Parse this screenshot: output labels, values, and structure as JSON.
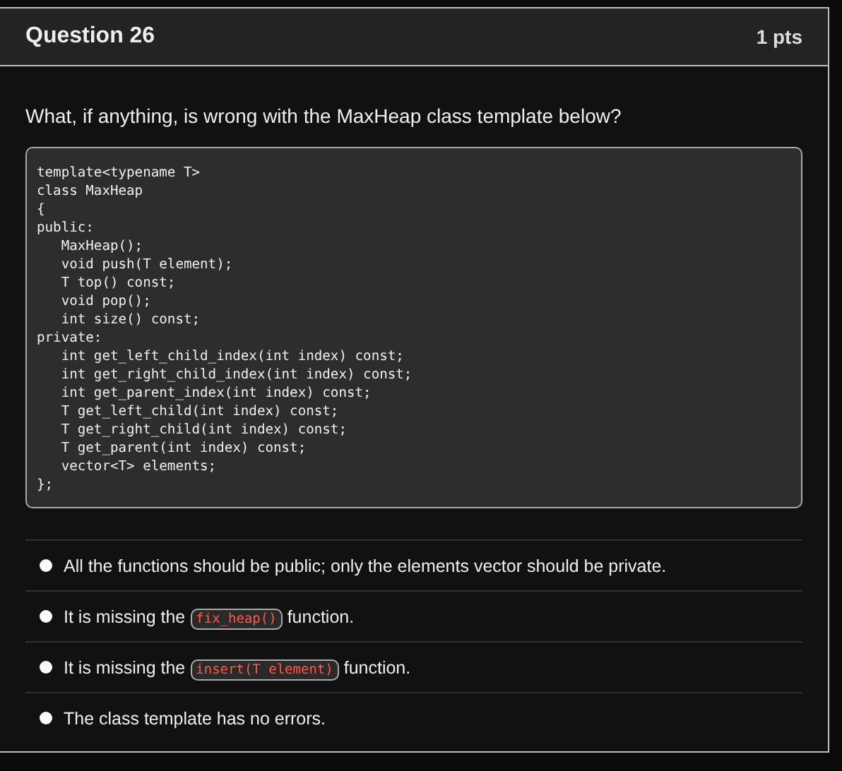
{
  "question": {
    "title": "Question 26",
    "points": "1 pts"
  },
  "prompt": "What, if anything, is wrong with the MaxHeap class template below?",
  "code_lines": [
    "template<typename T>",
    "class MaxHeap",
    "{",
    "public:",
    "   MaxHeap();",
    "   void push(T element);",
    "   T top() const;",
    "   void pop();",
    "   int size() const;",
    "private:",
    "   int get_left_child_index(int index) const;",
    "   int get_right_child_index(int index) const;",
    "   int get_parent_index(int index) const;",
    "   T get_left_child(int index) const;",
    "   T get_right_child(int index) const;",
    "   T get_parent(int index) const;",
    "   vector<T> elements;",
    "};"
  ],
  "answers": [
    {
      "selected": false,
      "parts": [
        {
          "kind": "text",
          "text": "All the functions should be public; only the elements vector should be private."
        }
      ]
    },
    {
      "selected": false,
      "parts": [
        {
          "kind": "text",
          "text": "It is missing the"
        },
        {
          "kind": "code",
          "text": "fix_heap()"
        },
        {
          "kind": "text",
          "text": "function."
        }
      ]
    },
    {
      "selected": false,
      "parts": [
        {
          "kind": "text",
          "text": "It is missing the"
        },
        {
          "kind": "code",
          "text": "insert(T element)"
        },
        {
          "kind": "text",
          "text": "function."
        }
      ]
    },
    {
      "selected": false,
      "parts": [
        {
          "kind": "text",
          "text": "The class template has no errors."
        }
      ]
    }
  ]
}
